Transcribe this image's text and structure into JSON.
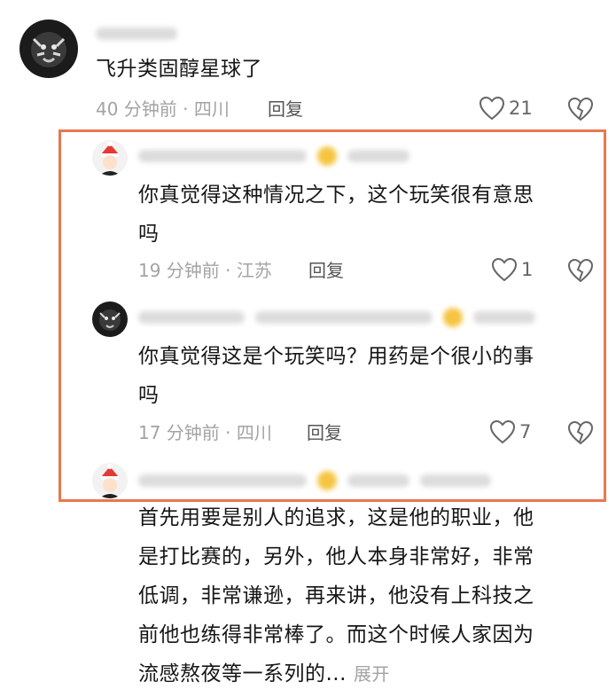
{
  "comments": [
    {
      "text": "飞升类固醇星球了",
      "meta": "40 分钟前 · 四川",
      "reply_label": "回复",
      "likes": "21"
    },
    {
      "text_line1": "你真觉得这种情况之下，这个玩笑很有意思",
      "text_line2": "吗",
      "meta": "19 分钟前 · 江苏",
      "reply_label": "回复",
      "likes": "1"
    },
    {
      "text_line1": "你真觉得这是个玩笑吗？用药是个很小的事",
      "text_line2": "吗",
      "meta": "17 分钟前 · 四川",
      "reply_label": "回复",
      "likes": "7"
    },
    {
      "lines": [
        "首先用要是别人的追求，这是他的职业，他",
        "是打比赛的，另外，他人本身非常好，非常",
        "低调，非常谦逊，再来讲，他没有上科技之",
        "前他也练得非常棒了。而这个时候人家因为"
      ],
      "last_line": "流感熬夜等一系列的...",
      "expand_label": "展开"
    }
  ],
  "colors": {
    "highlight": "#e9774e",
    "meta": "#a3a3a3"
  },
  "icons": {
    "like": "heart-outline-icon",
    "dislike": "broken-heart-icon"
  }
}
